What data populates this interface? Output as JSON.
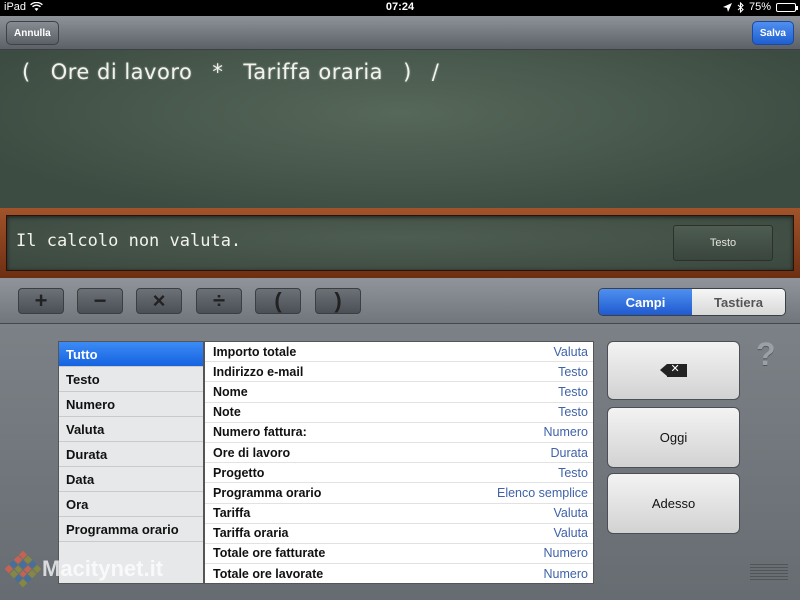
{
  "status_bar": {
    "device": "iPad",
    "time": "07:24",
    "battery": "75%",
    "battery_level": 0.75,
    "icons": [
      "wifi-icon",
      "location-icon",
      "bluetooth-icon",
      "battery-icon"
    ]
  },
  "nav": {
    "cancel_label": "Annulla",
    "save_label": "Salva"
  },
  "formula": {
    "tokens": [
      "(",
      "Ore di lavoro",
      "*",
      "Tariffa oraria",
      ")",
      "/"
    ]
  },
  "result": {
    "text": "Il calcolo non valuta.",
    "type_button": "Testo"
  },
  "operators": [
    "+",
    "−",
    "×",
    "÷",
    "(",
    ")"
  ],
  "segmented": {
    "active": "Campi",
    "inactive": "Tastiera"
  },
  "categories": [
    {
      "label": "Tutto",
      "selected": true
    },
    {
      "label": "Testo"
    },
    {
      "label": "Numero"
    },
    {
      "label": "Valuta"
    },
    {
      "label": "Durata"
    },
    {
      "label": "Data"
    },
    {
      "label": "Ora"
    },
    {
      "label": "Programma orario"
    }
  ],
  "fields": [
    {
      "name": "Importo totale",
      "type": "Valuta"
    },
    {
      "name": "Indirizzo e-mail",
      "type": "Testo"
    },
    {
      "name": "Nome",
      "type": "Testo"
    },
    {
      "name": "Note",
      "type": "Testo"
    },
    {
      "name": "Numero fattura:",
      "type": "Numero"
    },
    {
      "name": "Ore di lavoro",
      "type": "Durata"
    },
    {
      "name": "Progetto",
      "type": "Testo"
    },
    {
      "name": "Programma orario",
      "type": "Elenco semplice"
    },
    {
      "name": "Tariffa",
      "type": "Valuta"
    },
    {
      "name": "Tariffa oraria",
      "type": "Valuta"
    },
    {
      "name": "Totale ore fatturate",
      "type": "Numero"
    },
    {
      "name": "Totale ore lavorate",
      "type": "Numero"
    }
  ],
  "keys": {
    "backspace_icon": "backspace-icon",
    "today_label": "Oggi",
    "now_label": "Adesso"
  },
  "help_glyph": "?",
  "watermark": "Macitynet.it",
  "colors": {
    "accent_blue": "#1f5fd0",
    "chalkboard": "#46564b",
    "wood": "#8a4420",
    "field_type_text": "#3f62a8"
  }
}
